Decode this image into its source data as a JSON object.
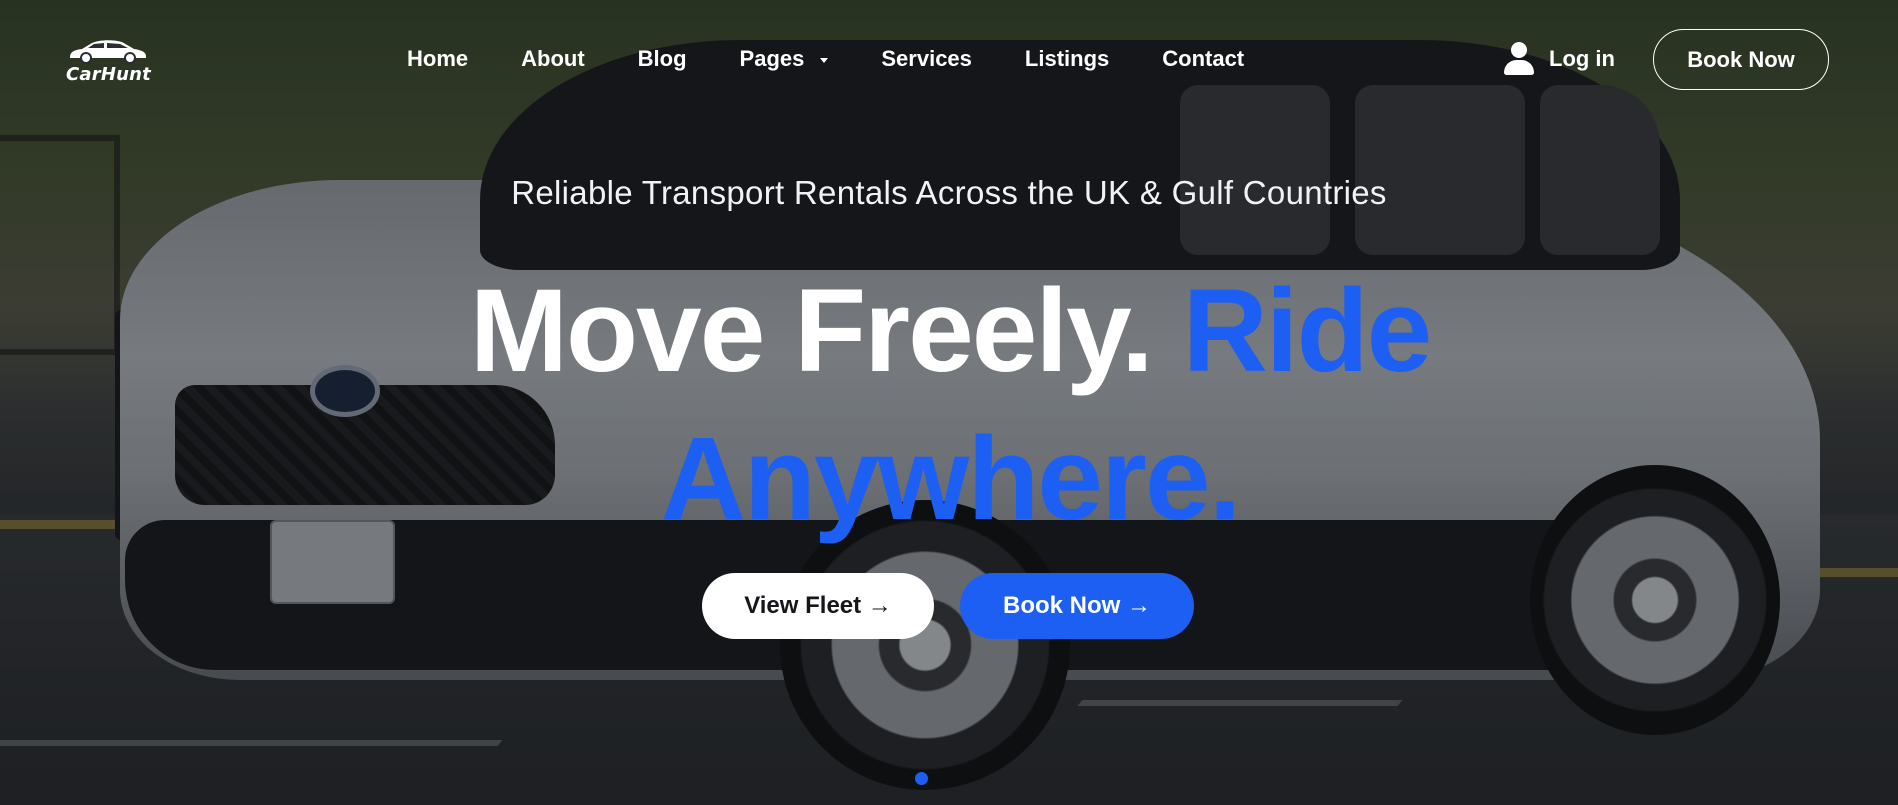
{
  "brand": {
    "name": "CarHunt"
  },
  "nav": {
    "items": [
      {
        "label": "Home"
      },
      {
        "label": "About"
      },
      {
        "label": "Blog"
      },
      {
        "label": "Pages"
      },
      {
        "label": "Services"
      },
      {
        "label": "Listings"
      },
      {
        "label": "Contact"
      }
    ],
    "login_label": "Log in",
    "book_label": "Book Now"
  },
  "hero": {
    "tagline": "Reliable Transport Rentals Across the UK & Gulf Countries",
    "headline_white": "Move Freely.",
    "headline_blue": "Ride Anywhere.",
    "view_fleet_label": "View Fleet →",
    "book_now_label": "Book Now →"
  },
  "icons": {
    "logo": "car-logo-icon",
    "user": "user-icon",
    "caret": "chevron-down-icon"
  },
  "colors": {
    "accent": "#1d5ff3",
    "text_light": "#ffffff"
  }
}
